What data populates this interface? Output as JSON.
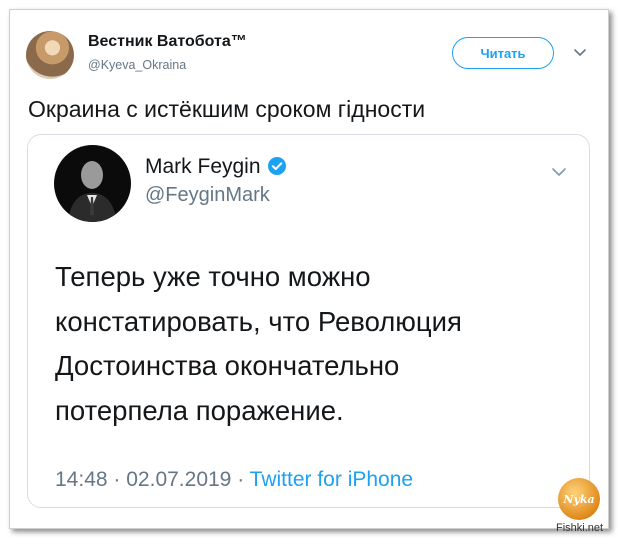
{
  "author": {
    "name": "Вестник Ватобота™",
    "handle": "@Kyeva_Okraina",
    "follow_label": "Читать"
  },
  "tweet": {
    "text": "Окраина с истёкшим сроком гідности"
  },
  "quoted": {
    "name": "Mark Feygin",
    "handle": "@FeyginMark",
    "body_lines": [
      "Теперь уже точно можно",
      "констатировать, что Революция",
      "Достоинства окончательно",
      "потерпела поражение."
    ],
    "time": "14:48",
    "date": "02.07.2019",
    "separator": "·",
    "source": "Twitter for iPhone"
  },
  "watermark": {
    "badge": "Nyka",
    "site": "Fishki.net"
  },
  "colors": {
    "accent": "#1da1f2",
    "text": "#14171a",
    "muted": "#657786"
  },
  "icons": [
    "avatar",
    "chevron-down-icon",
    "verified-badge-icon"
  ]
}
